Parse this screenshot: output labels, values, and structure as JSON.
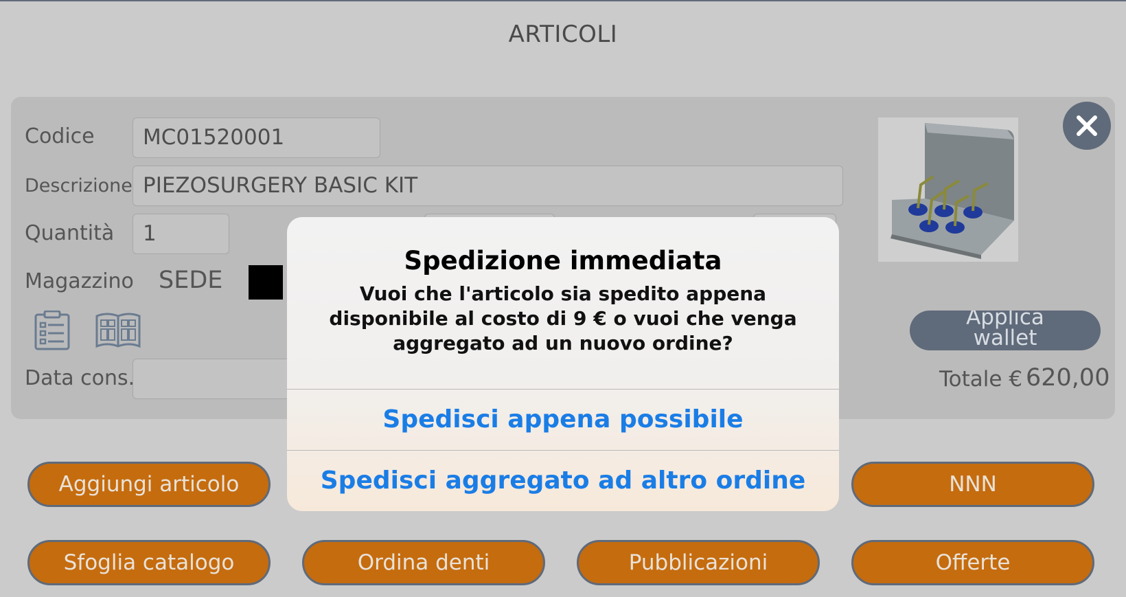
{
  "page": {
    "title": "ARTICOLI"
  },
  "form": {
    "codice_label": "Codice",
    "codice_value": "MC01520001",
    "descrizione_label": "Descrizione",
    "descrizione_value": "PIEZOSURGERY BASIC KIT",
    "quantita_label": "Quantità",
    "quantita_value": "1",
    "magazzino_label": "Magazzino",
    "magazzino_value": "SEDE",
    "data_cons_label": "Data cons.",
    "data_cons_value": ""
  },
  "wallet": {
    "label_line1": "Applica",
    "label_line2": "wallet"
  },
  "totale": {
    "label": "Totale €",
    "value": "620,00"
  },
  "buttons": {
    "aggiungi": "Aggiungi articolo",
    "nnn": "NNN",
    "sfoglia": "Sfoglia catalogo",
    "ordina": "Ordina denti",
    "pubblicazioni": "Pubblicazioni",
    "offerte": "Offerte"
  },
  "alert": {
    "title": "Spedizione immediata",
    "message": "Vuoi che l'articolo sia spedito appena disponibile al costo di 9 € o vuoi che venga aggregato ad un nuovo ordine?",
    "action_1": "Spedisci appena possibile",
    "action_2": "Spedisci aggregato ad altro ordine"
  },
  "icons": {
    "close": "close-icon",
    "checklist": "checklist-icon",
    "catalog": "catalog-book-icon"
  },
  "colors": {
    "accent_orange": "#c56c0f",
    "slate": "#5f6a7a",
    "link_blue": "#1a7de6"
  }
}
